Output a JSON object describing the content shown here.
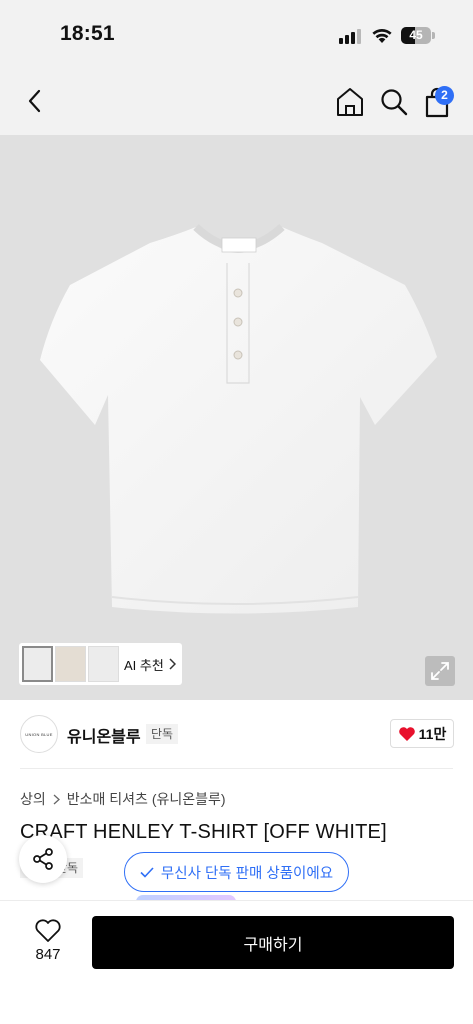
{
  "status_bar": {
    "time": "18:51",
    "battery": "45",
    "battery_fraction": 0.45
  },
  "header": {
    "back_icon": "chevron-left-icon",
    "home_icon": "home-icon",
    "search_icon": "search-icon",
    "cart_icon": "shopping-bag-icon",
    "cart_count": "2",
    "badge_color": "#2f6ff6"
  },
  "gallery": {
    "thumbnail_count": 3,
    "ai_recommend_label": "AI 추천",
    "expand_icon": "expand-icon"
  },
  "brand": {
    "logo_text": "UNION BLUE",
    "name": "유니온블루",
    "exclusive_label": "단독",
    "like_count": "11만",
    "heart_color": "#e8112d"
  },
  "breadcrumb": [
    "상의",
    "반소매 티셔츠 (유니온블루)"
  ],
  "product": {
    "title": "CRAFT HENLEY T-SHIRT [OFF WHITE]",
    "exclusive_label": "단독",
    "musinsa_exclusive_text": "무신사 단독 판매 상품이에요",
    "accent_color": "#2f6ff6"
  },
  "bottom_bar": {
    "wish_count": "847",
    "buy_label": "구매하기"
  }
}
